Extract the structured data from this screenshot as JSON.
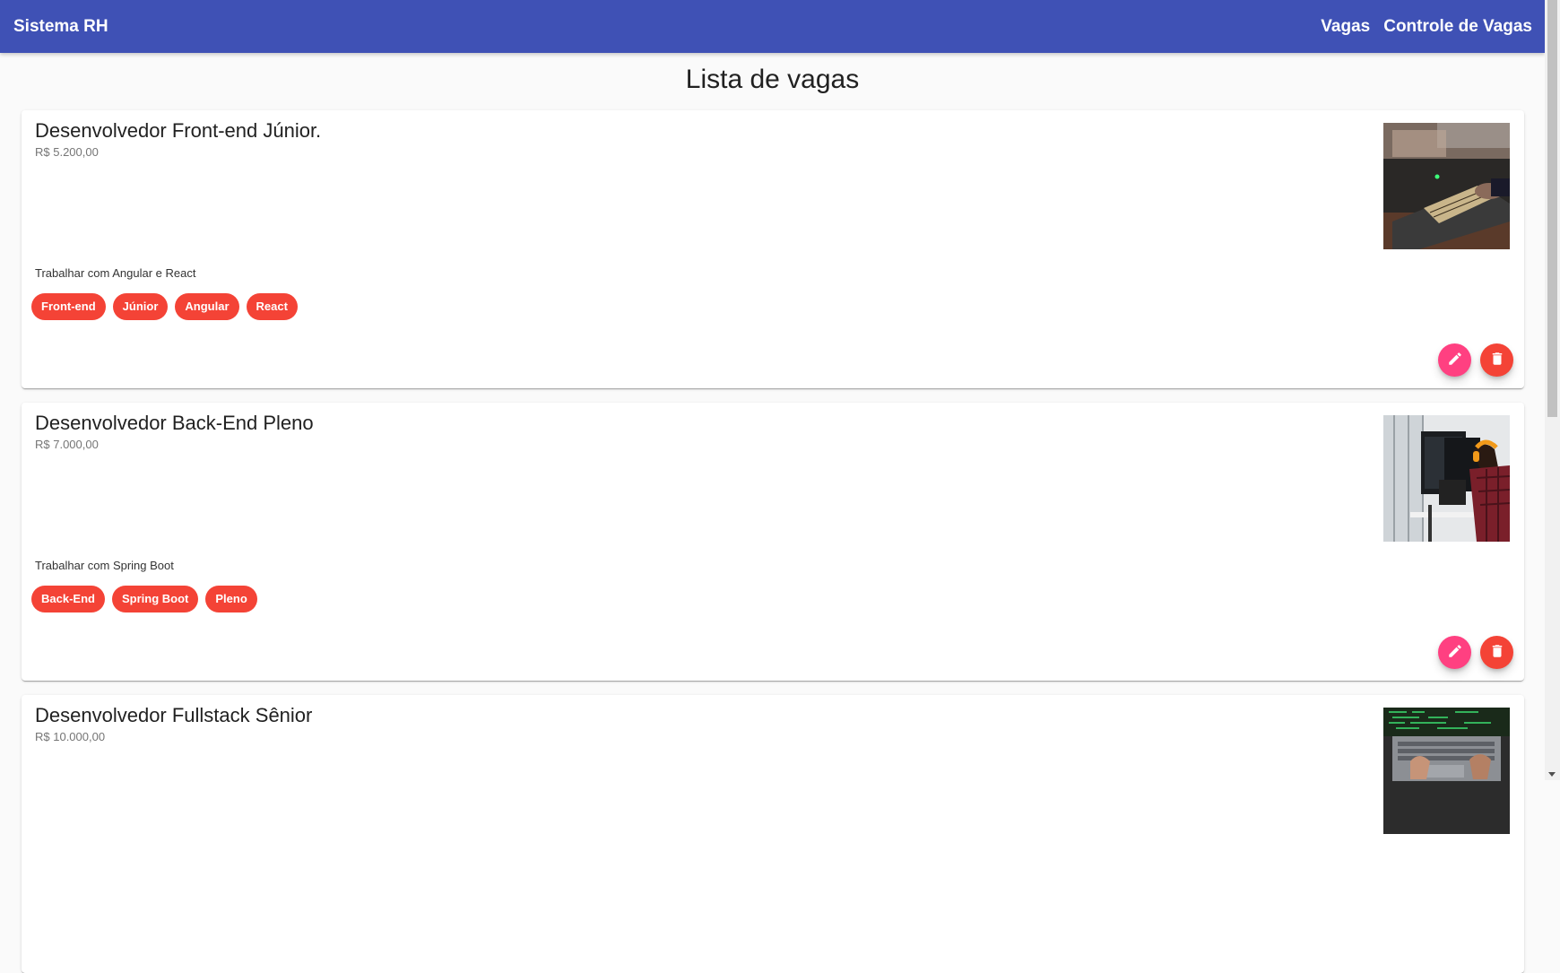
{
  "app": {
    "brand": "Sistema RH",
    "nav": [
      "Vagas",
      "Controle de Vagas"
    ]
  },
  "page": {
    "title": "Lista de vagas"
  },
  "jobs": [
    {
      "title": "Desenvolvedor Front-end Júnior.",
      "salary": "R$ 5.200,00",
      "description": "Trabalhar com Angular e React",
      "tags": [
        "Front-end",
        "Júnior",
        "Angular",
        "React"
      ],
      "image": "keyboard-desk-photo"
    },
    {
      "title": "Desenvolvedor Back-End Pleno",
      "salary": "R$ 7.000,00",
      "description": "Trabalhar com Spring Boot",
      "tags": [
        "Back-End",
        "Spring Boot",
        "Pleno"
      ],
      "image": "developer-monitors-photo"
    },
    {
      "title": "Desenvolvedor Fullstack Sênior",
      "salary": "R$ 10.000,00",
      "description": "",
      "tags": [],
      "image": "laptop-code-photo"
    }
  ],
  "icons": {
    "edit": "pencil-icon",
    "delete": "trash-icon"
  },
  "colors": {
    "toolbar": "#3f51b5",
    "chip": "#f44336",
    "edit_fab": "#ff4081",
    "delete_fab": "#f44336"
  }
}
